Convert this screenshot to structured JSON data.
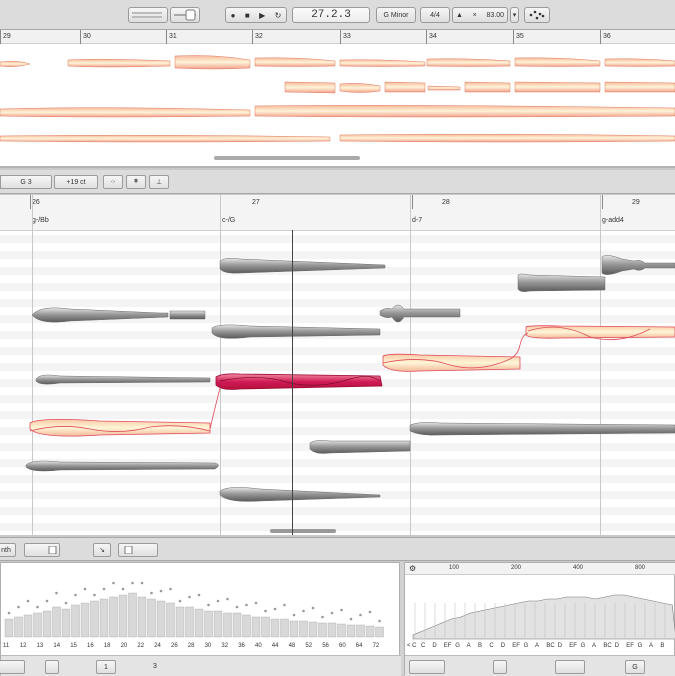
{
  "transport": {
    "position": "27.2.3",
    "key": "G Minor",
    "time_signature": "4/4",
    "tempo": "83.00",
    "record_icon": "record-icon",
    "stop_icon": "stop-icon",
    "play_icon": "play-icon",
    "loop_icon": "loop-icon"
  },
  "overview": {
    "bars": [
      "29",
      "30",
      "31",
      "32",
      "33",
      "34",
      "35",
      "36"
    ]
  },
  "editor_toolbar": {
    "pitch": "G 3",
    "cents": "+19 ct"
  },
  "editor": {
    "bars": [
      "26",
      "27",
      "28",
      "29"
    ],
    "chords": [
      "g-/Bb",
      "c-/G",
      "d-7",
      "g-add4"
    ]
  },
  "bottom": {
    "left_label": "nth",
    "left_numbers": [
      "11",
      "12",
      "13",
      "14",
      "15",
      "16",
      "18",
      "20",
      "22",
      "24",
      "26",
      "28",
      "30",
      "32",
      "36",
      "40",
      "44",
      "48",
      "52",
      "56",
      "60",
      "64",
      "72"
    ],
    "left_field": "1",
    "left_field2": "3",
    "right_numbers": [
      "100",
      "200",
      "400",
      "800"
    ],
    "right_notes": [
      "C",
      "D",
      "EF",
      "G",
      "A",
      "B",
      "C",
      "D",
      "EF",
      "G",
      "A",
      "BC",
      "D",
      "EF",
      "G",
      "A",
      "BC",
      "D",
      "EF",
      "G",
      "A",
      "B"
    ],
    "right_first": "< C",
    "right_g": "G"
  }
}
